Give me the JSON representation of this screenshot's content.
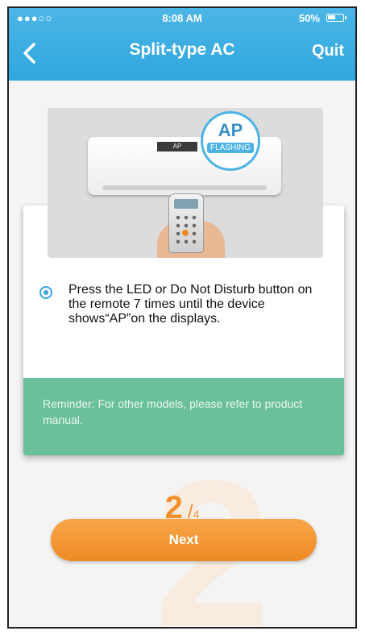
{
  "status_bar": {
    "signal": "●●●○○",
    "time": "8:08 AM",
    "battery": "50%"
  },
  "nav": {
    "title": "Split-type AC",
    "quit_label": "Quit",
    "back_icon": "chevron-left-icon"
  },
  "illustration": {
    "display_text": "AP",
    "bubble_title": "AP",
    "bubble_subtitle": "FLASHING"
  },
  "card": {
    "instruction": "Press the LED or Do Not Disturb button on the remote 7 times until the device shows“AP”on the displays.",
    "reminder": "Reminder: For other models, please refer to product manual."
  },
  "step": {
    "current": "2",
    "separator": "/",
    "total": "4"
  },
  "next_label": "Next",
  "colors": {
    "header": "#2fa6df",
    "accent_orange": "#ee8a22",
    "reminder_green": "#6ac09a"
  }
}
